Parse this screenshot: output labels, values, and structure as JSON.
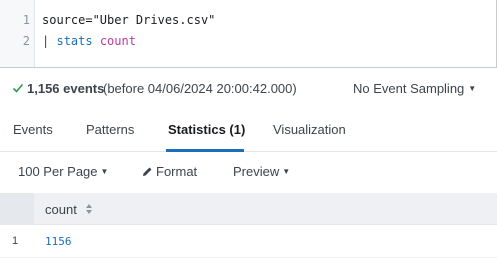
{
  "editor": {
    "lines": [
      {
        "number": "1",
        "text": "source=\"Uber Drives.csv\""
      },
      {
        "number": "2",
        "pipe": "|",
        "command": "stats",
        "function": "count"
      }
    ]
  },
  "status": {
    "check_icon": "checkmark-icon",
    "events_count": "1,156 events",
    "events_before": "(before 04/06/2024 20:00:42.000)",
    "sampling": "No Event Sampling"
  },
  "tabs": [
    {
      "label": "Events",
      "active": false
    },
    {
      "label": "Patterns",
      "active": false
    },
    {
      "label": "Statistics (1)",
      "active": true
    },
    {
      "label": "Visualization",
      "active": false
    }
  ],
  "toolbar": {
    "per_page": "100 Per Page",
    "format": "Format",
    "preview": "Preview"
  },
  "table": {
    "columns": [
      "count"
    ],
    "rows": [
      {
        "index": "1",
        "count": "1156"
      }
    ]
  },
  "colors": {
    "accent": "#1a6fb8",
    "success": "#2a9d3f",
    "function_keyword": "#c0399b"
  }
}
